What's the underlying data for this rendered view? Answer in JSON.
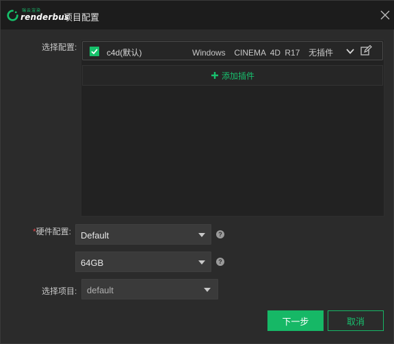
{
  "window": {
    "brand_sub": "瑞云渲染",
    "brand_name": "renderbus",
    "title": "项目配置"
  },
  "labels": {
    "select_config": "选择配置:",
    "hardware_config_required": "*",
    "hardware_config": "硬件配置:",
    "select_project": "选择项目:"
  },
  "config": {
    "checked": true,
    "name": "c4d(默认)",
    "os": "Windows",
    "software": "CINEMA 4D R17",
    "plugins": "无插件",
    "add_plugin_label": "添加插件"
  },
  "hardware": {
    "preset": {
      "selected": "Default"
    },
    "memory": {
      "selected": "64GB"
    },
    "help_glyph": "?"
  },
  "project": {
    "selected": "default"
  },
  "buttons": {
    "next": "下一步",
    "cancel": "取消"
  },
  "colors": {
    "accent": "#16c06a",
    "required": "#e5484d"
  },
  "icons": {
    "logo": "renderbus-logo-icon",
    "close": "close-icon",
    "checkbox": "checkbox-checked-icon",
    "expand": "chevron-down-icon",
    "edit": "edit-icon",
    "add": "plus-icon",
    "dropdown": "caret-down-icon",
    "help": "help-icon"
  }
}
